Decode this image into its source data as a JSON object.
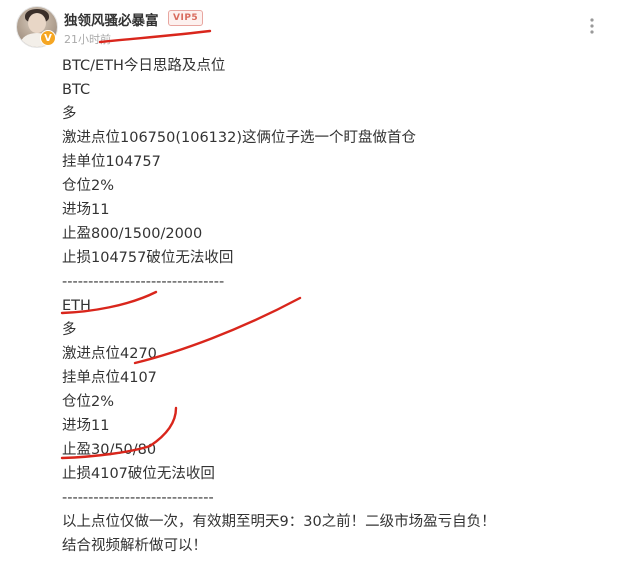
{
  "post": {
    "author": {
      "name": "独领风骚必暴富",
      "vip_label": "VIP5",
      "verified_mark": "V"
    },
    "timestamp": "21小时前",
    "lines": [
      "BTC/ETH今日思路及点位",
      "BTC",
      "多",
      "激进点位106750(106132)这俩位子选一个盯盘做首仓",
      "挂单位104757",
      "仓位2%",
      "进场11",
      "止盈800/1500/2000",
      "止损104757破位无法收回",
      "-------------------------------",
      "ETH",
      "多",
      "激进点位4270",
      "挂单点位4107",
      "仓位2%",
      "进场11",
      "止盈30/50/80",
      "止损4107破位无法收回",
      "-----------------------------",
      "以上点位仅做一次，有效期至明天9：30之前！二级市场盈亏自负！",
      "结合视频解析做可以！"
    ]
  },
  "colors": {
    "annotation": "#d9261c",
    "text": "#333333",
    "meta": "#aaaaaa",
    "vip": "#d96c5e"
  },
  "icons": {
    "more": "more-vertical-icon",
    "verified": "verified-v-icon"
  }
}
